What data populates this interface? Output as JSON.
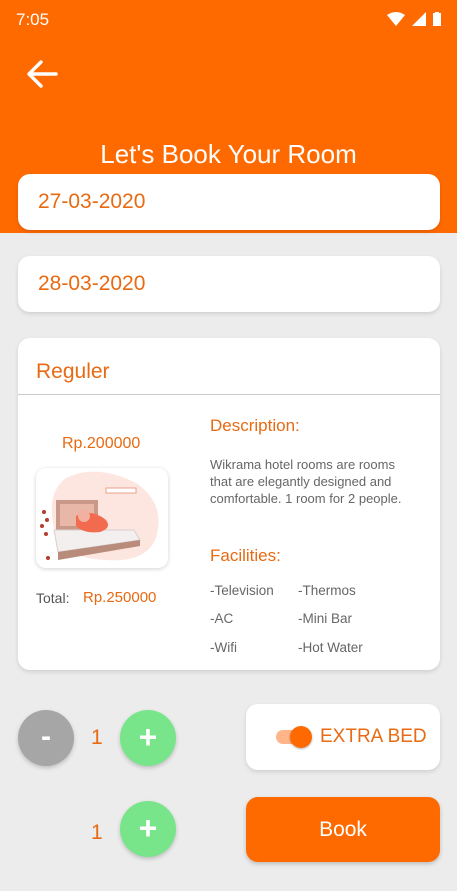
{
  "status_bar": {
    "time": "7:05"
  },
  "header": {
    "title": "Let's Book Your Room"
  },
  "check_in": {
    "date": "27-03-2020"
  },
  "check_out": {
    "date": "28-03-2020"
  },
  "room": {
    "name": "Reguler",
    "price": "Rp.200000",
    "total_label": "Total:",
    "total_value": "Rp.250000",
    "description_title": "Description:",
    "description": "Wikrama hotel rooms are rooms that are elegantly designed and comfortable. 1 room for 2 people.",
    "facilities_title": "Facilities:",
    "facilities": [
      "-Television",
      "-Thermos",
      "-AC",
      "-Mini Bar",
      "-Wifi",
      "-Hot Water"
    ]
  },
  "room_counter": {
    "minus_symbol": "-",
    "plus_symbol": "+",
    "count": "1"
  },
  "extra_bed": {
    "label": "EXTRA BED",
    "enabled": true
  },
  "bed_counter": {
    "plus_symbol": "+",
    "count": "1"
  },
  "book_button": {
    "label": "Book"
  },
  "colors": {
    "primary": "#ff6a00",
    "accent_text": "#e86a12",
    "plus": "#78e58a",
    "minus": "#a6a6a6"
  }
}
